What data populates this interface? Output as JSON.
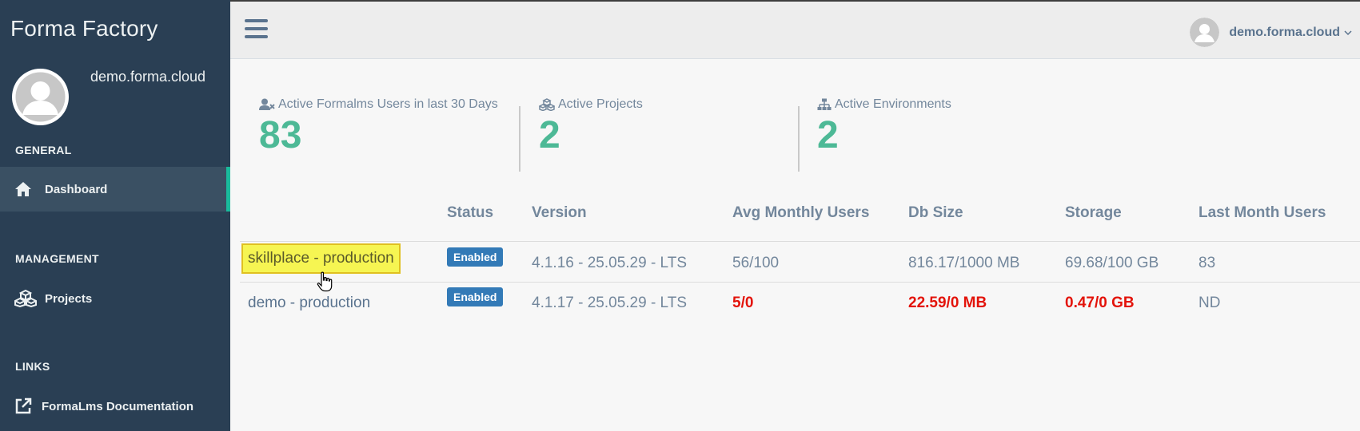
{
  "sidebar": {
    "brand": "Forma Factory",
    "profile_name": "demo.forma.cloud",
    "sections": {
      "general": "GENERAL",
      "management": "MANAGEMENT",
      "links": "LINKS"
    },
    "items": {
      "dashboard": "Dashboard",
      "projects": "Projects",
      "documentation": "FormaLms Documentation"
    }
  },
  "topbar": {
    "user_name": "demo.forma.cloud"
  },
  "stats": [
    {
      "label": "Active Formalms Users in last 30 Days",
      "value": "83",
      "icon": "user-times-icon"
    },
    {
      "label": "Active Projects",
      "value": "2",
      "icon": "cubes-icon"
    },
    {
      "label": "Active Environments",
      "value": "2",
      "icon": "sitemap-icon"
    }
  ],
  "table": {
    "headers": {
      "status": "Status",
      "version": "Version",
      "avg_users": "Avg Monthly Users",
      "db_size": "Db Size",
      "storage": "Storage",
      "last_month": "Last Month Users"
    },
    "rows": [
      {
        "name": "skillplace - production",
        "status": "Enabled",
        "version": "4.1.16 - 25.05.29 - LTS",
        "avg_users": "56/100",
        "db_size": "816.17/1000 MB",
        "storage": "69.68/100 GB",
        "last_month": "83"
      },
      {
        "name": "demo - production",
        "status": "Enabled",
        "version": "4.1.17 - 25.05.29 - LTS",
        "avg_users": "5/0",
        "db_size": "22.59/0 MB",
        "storage": "0.47/0 GB",
        "last_month": "ND"
      }
    ]
  },
  "colors": {
    "sidebar_bg": "#2a3f54",
    "accent_green": "#1abb9c",
    "stat_value": "#4db996",
    "badge_blue": "#337ab7",
    "alert_red": "#e3130a",
    "highlight_yellow": "#f6f552"
  }
}
